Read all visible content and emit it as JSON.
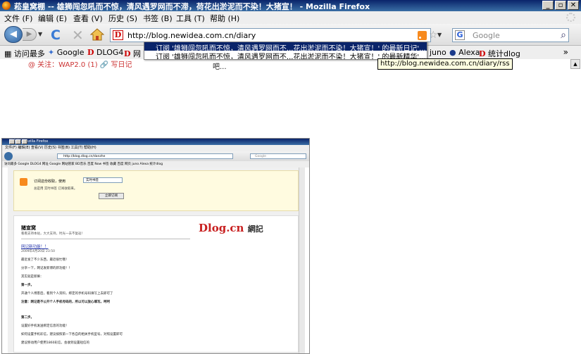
{
  "window": {
    "title": "菘皇窝棚 -- 雄狮闯忽吼而不惊，清风遇罗网而不滞，荷花出淤泥而不染！大猪宣！ - Mozilla Firefox",
    "minimize": "_",
    "maximize": "▫",
    "close": "✕"
  },
  "menu": [
    "文件 (F)",
    "编辑 (E)",
    "查看 (V)",
    "历史 (S)",
    "书签 (B)",
    "工具 (T)",
    "帮助 (H)"
  ],
  "nav": {
    "url": "http://blog.newidea.com.cn/diary",
    "site_badge": "D",
    "search_engine_badge": "G",
    "search_placeholder": "Google"
  },
  "bookmarks": {
    "most_visited": "访问最多",
    "google": "Google",
    "dlog4": "DLOG4",
    "net": "网",
    "juno": "juno",
    "alexa": "Alexa",
    "stats": "统计dlog",
    "chevron": "»"
  },
  "rss_menu": [
    "订阅 '雄狮闯忽吼而不惊，清风遇罗网而不...花出淤泥而不染！大猪宣！' 的最新日记'...",
    "订阅 '雄狮闯忽吼而不惊，清风遇罗网而不...花出淤泥而不染！大猪宣！' 的最新精华'..."
  ],
  "tooltip": "http://blog.newidea.com.cn/diary/rss",
  "page_peek": {
    "left": "@ 关注：WAP2.0 (1)  🔗 写日记",
    "right": "吧..."
  },
  "thumbnail": {
    "title": "猪宣窝 - Mozilla Firefox",
    "menu": "文件(F)  编辑(E)  查看(V)  历史(S)  书签(B)  工具(T)  帮助(H)",
    "url": "http://blog.dlog.cn/danzhe",
    "search": "Google",
    "bookmarks": "访问最多  Google  DLOG4  网址  Google  网站管家  BD音乐  百度  Now  书签  收藏  百度  网页  juno  Alexa  统计dlog",
    "subscribe_line1": "订阅这份收取，使用",
    "subscribe_select": "实时书签",
    "subscribe_line2": "总是用 实时书签 订阅收取来。",
    "subscribe_button": "立即订阅",
    "blog_title": "猪宣窝",
    "blog_desc": "看看支持本站，大大支持，时光一去不复返！",
    "logo_main": "Dlog.cn",
    "logo_sub": "網記",
    "post_title": "网记新功能！！",
    "post_date": "2009年4月20日 23:50",
    "lines": [
      "最近发了不少东西，最近很忙哦！",
      "分享一下，网记发新博的新功能！！",
      "其实就是新嘛：",
      "第一步。",
      "开通个人博客后，看到个人资料，绑定的手机号码填写上去即可了",
      "注意：网记是不公开个人手机号码的，所以可以放心填写。呵呵",
      "第二步。",
      "设置好手机发送绑定信息的功能！",
      "如何设置手机彩信，建议按照第一下各自的相关手机型号，对照设置即可",
      "建议移动用户使用1860彩信，会收到设置短信的"
    ]
  }
}
